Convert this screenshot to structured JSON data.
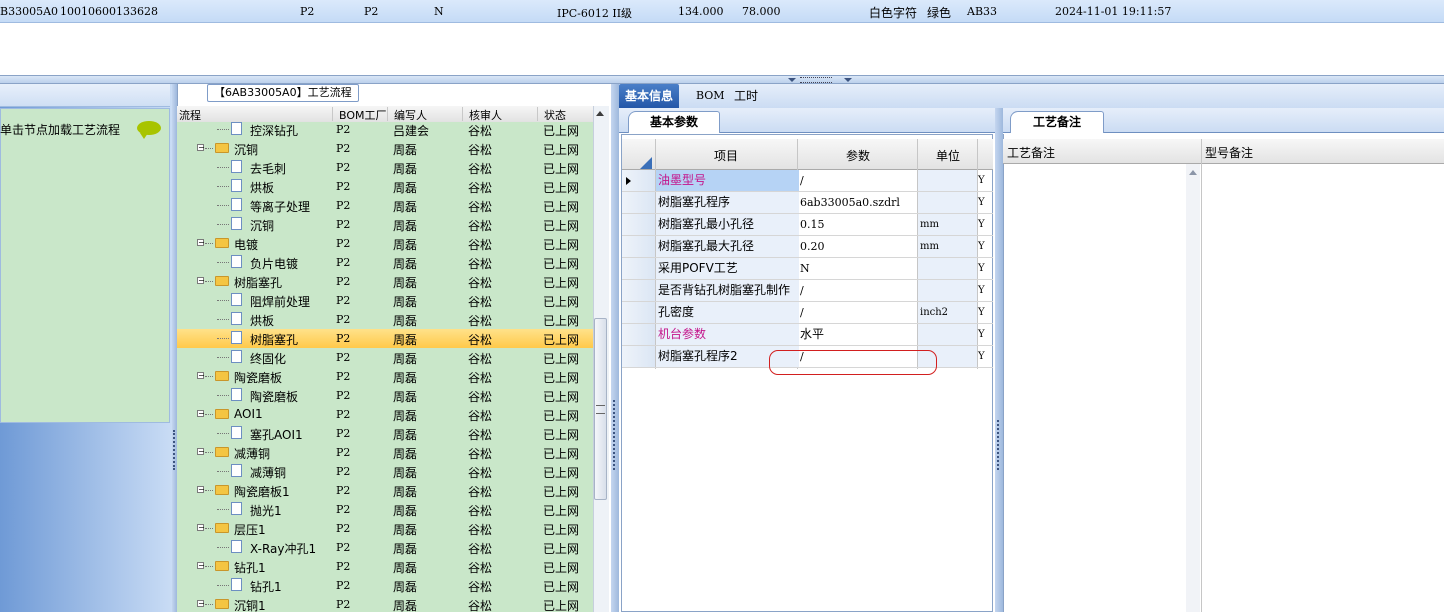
{
  "top_row": {
    "code": "B33005A0",
    "number": "10010600133628",
    "col_a": "P2",
    "col_b": "P2",
    "col_c": "N",
    "spec": "IPC-6012 II级",
    "val1": "134.000",
    "val2": "78.000",
    "char_color": "白色字符",
    "mask_color": "绿色",
    "model": "AB33",
    "datetime": "2024-11-01 19:11:57"
  },
  "left_panel": {
    "hint": "单击节点加载工艺流程"
  },
  "tree": {
    "title": "【6AB33005A0】工艺流程",
    "headers": [
      "流程",
      "BOM工厂",
      "编写人",
      "核审人",
      "状态"
    ],
    "rows": [
      {
        "name": "控深钻孔",
        "type": "doc",
        "factory": "P2",
        "writer": "吕建会",
        "reviewer": "谷松",
        "status": "已上网"
      },
      {
        "name": "沉铜",
        "type": "folder",
        "factory": "P2",
        "writer": "周磊",
        "reviewer": "谷松",
        "status": "已上网"
      },
      {
        "name": "去毛刺",
        "type": "doc",
        "factory": "P2",
        "writer": "周磊",
        "reviewer": "谷松",
        "status": "已上网"
      },
      {
        "name": "烘板",
        "type": "doc",
        "factory": "P2",
        "writer": "周磊",
        "reviewer": "谷松",
        "status": "已上网"
      },
      {
        "name": "等离子处理",
        "type": "doc",
        "factory": "P2",
        "writer": "周磊",
        "reviewer": "谷松",
        "status": "已上网"
      },
      {
        "name": "沉铜",
        "type": "doc",
        "factory": "P2",
        "writer": "周磊",
        "reviewer": "谷松",
        "status": "已上网"
      },
      {
        "name": "电镀",
        "type": "folder",
        "factory": "P2",
        "writer": "周磊",
        "reviewer": "谷松",
        "status": "已上网"
      },
      {
        "name": "负片电镀",
        "type": "doc",
        "factory": "P2",
        "writer": "周磊",
        "reviewer": "谷松",
        "status": "已上网"
      },
      {
        "name": "树脂塞孔",
        "type": "folder",
        "factory": "P2",
        "writer": "周磊",
        "reviewer": "谷松",
        "status": "已上网"
      },
      {
        "name": "阻焊前处理",
        "type": "doc",
        "factory": "P2",
        "writer": "周磊",
        "reviewer": "谷松",
        "status": "已上网"
      },
      {
        "name": "烘板",
        "type": "doc",
        "factory": "P2",
        "writer": "周磊",
        "reviewer": "谷松",
        "status": "已上网"
      },
      {
        "name": "树脂塞孔",
        "type": "doc",
        "factory": "P2",
        "writer": "周磊",
        "reviewer": "谷松",
        "status": "已上网",
        "selected": true
      },
      {
        "name": "终固化",
        "type": "doc",
        "factory": "P2",
        "writer": "周磊",
        "reviewer": "谷松",
        "status": "已上网"
      },
      {
        "name": "陶瓷磨板",
        "type": "folder",
        "factory": "P2",
        "writer": "周磊",
        "reviewer": "谷松",
        "status": "已上网"
      },
      {
        "name": "陶瓷磨板",
        "type": "doc",
        "factory": "P2",
        "writer": "周磊",
        "reviewer": "谷松",
        "status": "已上网"
      },
      {
        "name": "AOI1",
        "type": "folder",
        "factory": "P2",
        "writer": "周磊",
        "reviewer": "谷松",
        "status": "已上网"
      },
      {
        "name": "塞孔AOI1",
        "type": "doc",
        "factory": "P2",
        "writer": "周磊",
        "reviewer": "谷松",
        "status": "已上网"
      },
      {
        "name": "减薄铜",
        "type": "folder",
        "factory": "P2",
        "writer": "周磊",
        "reviewer": "谷松",
        "status": "已上网"
      },
      {
        "name": "减薄铜",
        "type": "doc",
        "factory": "P2",
        "writer": "周磊",
        "reviewer": "谷松",
        "status": "已上网"
      },
      {
        "name": "陶瓷磨板1",
        "type": "folder",
        "factory": "P2",
        "writer": "周磊",
        "reviewer": "谷松",
        "status": "已上网"
      },
      {
        "name": "抛光1",
        "type": "doc",
        "factory": "P2",
        "writer": "周磊",
        "reviewer": "谷松",
        "status": "已上网"
      },
      {
        "name": "层压1",
        "type": "folder",
        "factory": "P2",
        "writer": "周磊",
        "reviewer": "谷松",
        "status": "已上网"
      },
      {
        "name": "X-Ray冲孔1",
        "type": "doc",
        "factory": "P2",
        "writer": "周磊",
        "reviewer": "谷松",
        "status": "已上网"
      },
      {
        "name": "钻孔1",
        "type": "folder",
        "factory": "P2",
        "writer": "周磊",
        "reviewer": "谷松",
        "status": "已上网"
      },
      {
        "name": "钻孔1",
        "type": "doc",
        "factory": "P2",
        "writer": "周磊",
        "reviewer": "谷松",
        "status": "已上网"
      },
      {
        "name": "沉铜1",
        "type": "folder",
        "factory": "P2",
        "writer": "周磊",
        "reviewer": "谷松",
        "status": "已上网"
      }
    ]
  },
  "tabs": [
    "基本信息",
    "BOM",
    "工时"
  ],
  "params": {
    "tab_label": "基本参数",
    "headers": [
      "项目",
      "参数",
      "单位"
    ],
    "rows": [
      {
        "item": "油墨型号",
        "value": "/",
        "unit": "",
        "flag": "Y",
        "style": "pink-hl"
      },
      {
        "item": "树脂塞孔程序",
        "value": "6ab33005a0.szdrl",
        "unit": "",
        "flag": "Y"
      },
      {
        "item": "树脂塞孔最小孔径",
        "value": "0.15",
        "unit": "mm",
        "flag": "Y"
      },
      {
        "item": "树脂塞孔最大孔径",
        "value": "0.20",
        "unit": "mm",
        "flag": "Y"
      },
      {
        "item": "采用POFV工艺",
        "value": "N",
        "unit": "",
        "flag": "Y"
      },
      {
        "item": "是否背钻孔树脂塞孔制作",
        "value": "/",
        "unit": "",
        "flag": "Y"
      },
      {
        "item": "孔密度",
        "value": "/",
        "unit": "inch2",
        "flag": "Y"
      },
      {
        "item": "机台参数",
        "value": "水平",
        "unit": "",
        "flag": "Y",
        "style": "pink"
      },
      {
        "item": "树脂塞孔程序2",
        "value": "/",
        "unit": "",
        "flag": "Y"
      }
    ]
  },
  "notes": {
    "tab_label": "工艺备注",
    "headers": [
      "工艺备注",
      "型号备注"
    ]
  },
  "colors": {
    "tree_bg": "#c9e7c9",
    "selected_row": "#ffc94a",
    "tab_active": "#2457a8",
    "pink_text": "#c4138a",
    "red_mark": "#d21f1f"
  }
}
